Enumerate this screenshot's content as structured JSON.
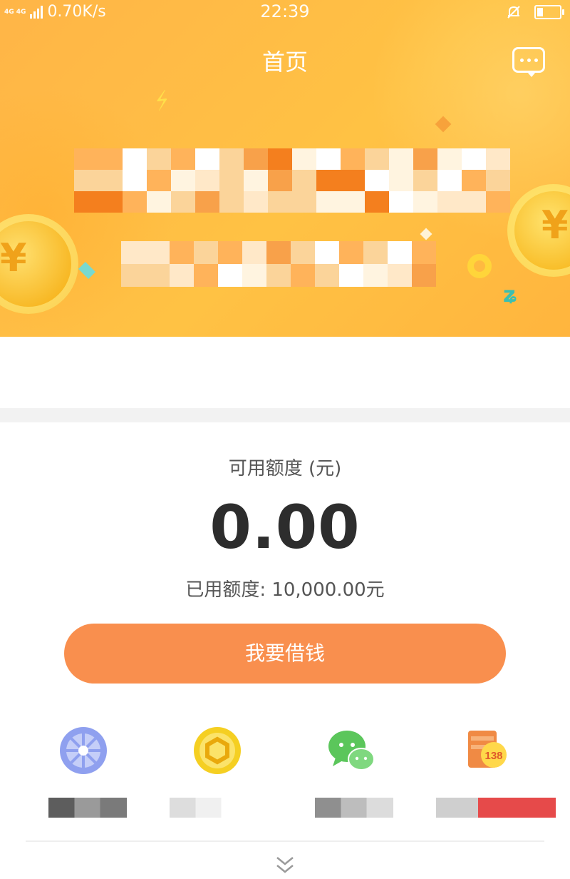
{
  "status_bar": {
    "network_tag": "4G 4G",
    "speed": "0.70K/s",
    "time": "22:39",
    "battery_level": 0.3,
    "icons": [
      "signal-icon",
      "mute-bell-icon",
      "battery-icon"
    ]
  },
  "header": {
    "title": "首页",
    "message_icon": "chat-bubble-icon"
  },
  "banner": {
    "colors": {
      "main": "#ffb547",
      "light": "#ffc244"
    },
    "coin_glyph": "¥",
    "obscured_text_lines": 2
  },
  "credit": {
    "available_label": "可用额度 (元)",
    "available_amount": "0.00",
    "used_text": "已用额度: 10,000.00元",
    "borrow_button": "我要借钱"
  },
  "shortcuts": [
    {
      "icon": "wheel-icon",
      "color": "#8fa0ef"
    },
    {
      "icon": "gold-coin-icon",
      "color": "#f5cf22"
    },
    {
      "icon": "wechat-icon",
      "color": "#5bc65b"
    },
    {
      "icon": "gift-138-icon",
      "color": "#f08a44",
      "badge": "138"
    }
  ],
  "footer": {
    "more_icon": "double-chevron-down-icon"
  },
  "accent_color": "#f98f4e"
}
